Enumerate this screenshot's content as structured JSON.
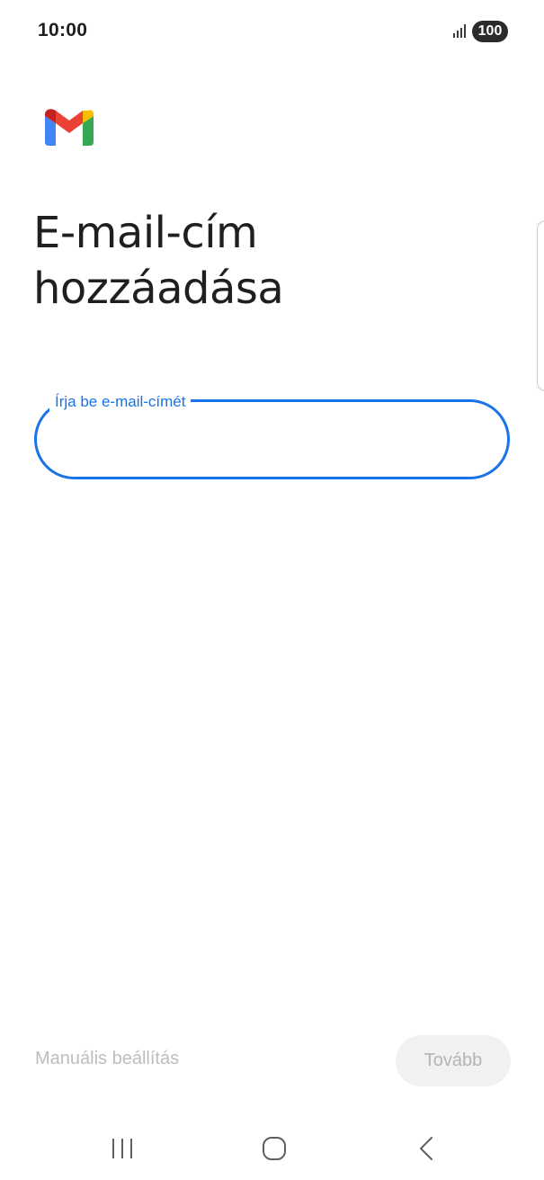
{
  "status_bar": {
    "time": "10:00",
    "battery": "100",
    "signal_icon": "signal-bars-icon"
  },
  "app": {
    "logo_icon": "gmail-logo-icon"
  },
  "page": {
    "title": "E-mail-cím hozzáadása"
  },
  "email_input": {
    "label": "Írja be e-mail-címét",
    "value": ""
  },
  "footer": {
    "manual_setup_label": "Manuális beállítás",
    "next_label": "Tovább"
  },
  "nav_bar": {
    "recents_icon": "recents-icon",
    "home_icon": "home-icon",
    "back_icon": "back-icon"
  },
  "colors": {
    "accent": "#1a73e8",
    "disabled_text": "#b3b3b3",
    "disabled_button_bg": "#f1f1f1"
  }
}
